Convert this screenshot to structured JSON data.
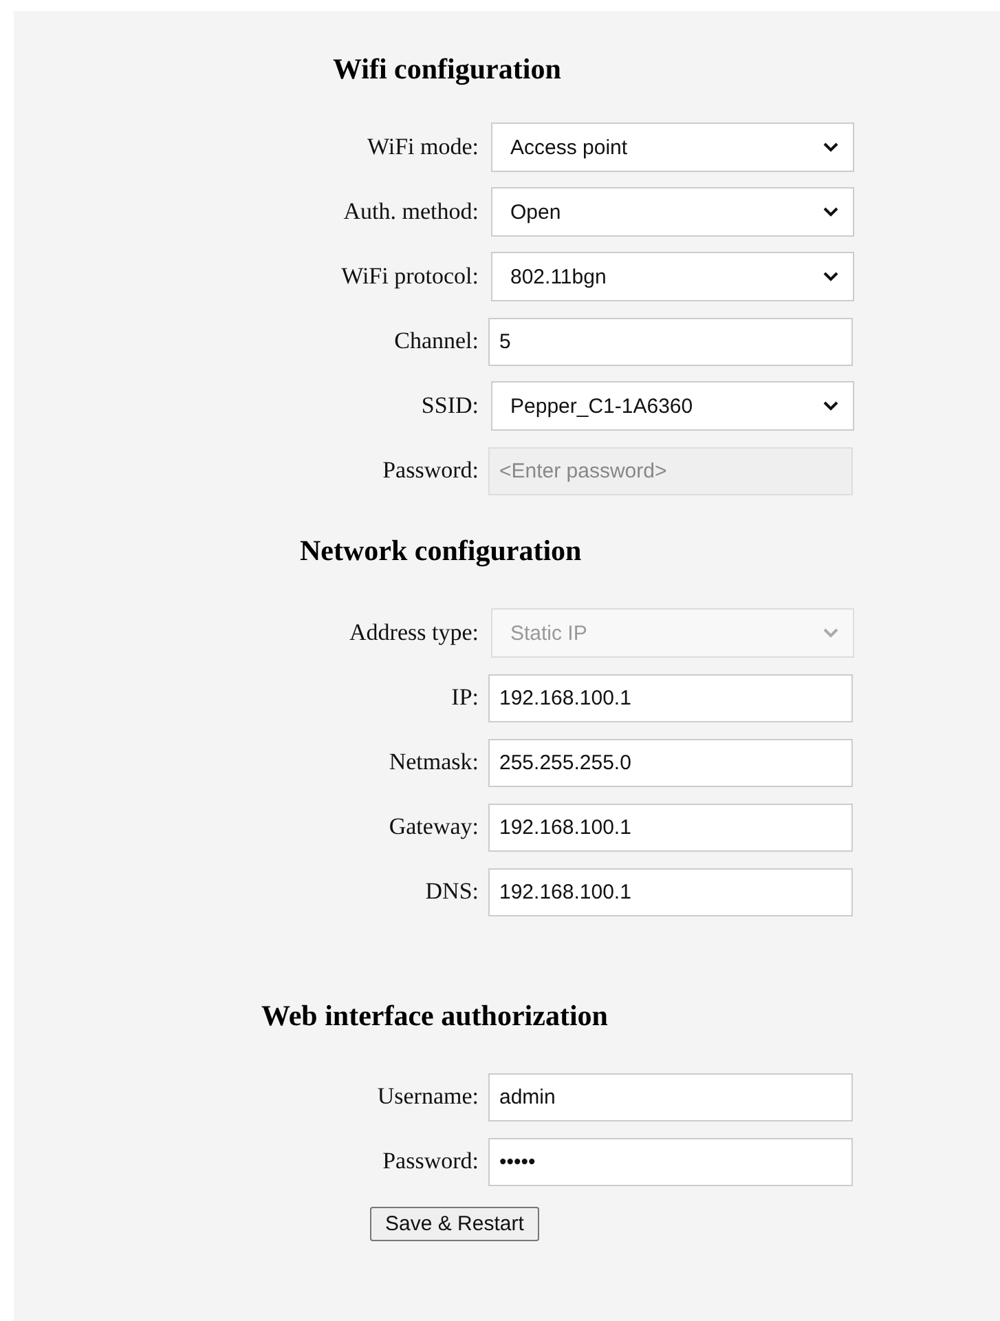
{
  "sections": [
    {
      "title": "Wifi configuration",
      "rows": [
        {
          "label": "WiFi mode:",
          "kind": "select",
          "value": "Access point",
          "disabled": false
        },
        {
          "label": "Auth. method:",
          "kind": "select",
          "value": "Open",
          "disabled": false
        },
        {
          "label": "WiFi protocol:",
          "kind": "select",
          "value": "802.11bgn",
          "disabled": false
        },
        {
          "label": "Channel:",
          "kind": "text",
          "value": "5",
          "disabled": false
        },
        {
          "label": "SSID:",
          "kind": "select",
          "value": "Pepper_C1-1A6360",
          "disabled": false
        },
        {
          "label": "Password:",
          "kind": "text",
          "placeholder": "<Enter password>",
          "disabled": true
        }
      ]
    },
    {
      "title": "Network configuration",
      "rows": [
        {
          "label": "Address type:",
          "kind": "select",
          "value": "Static IP",
          "disabled": true
        },
        {
          "label": "IP:",
          "kind": "text",
          "value": "192.168.100.1",
          "disabled": false
        },
        {
          "label": "Netmask:",
          "kind": "text",
          "value": "255.255.255.0",
          "disabled": false
        },
        {
          "label": "Gateway:",
          "kind": "text",
          "value": "192.168.100.1",
          "disabled": false
        },
        {
          "label": "DNS:",
          "kind": "text",
          "value": "192.168.100.1",
          "disabled": false
        }
      ]
    },
    {
      "title": "Web interface authorization",
      "rows": [
        {
          "label": "Username:",
          "kind": "text",
          "value": "admin",
          "disabled": false
        },
        {
          "label": "Password:",
          "kind": "text",
          "value": "•••••",
          "disabled": false
        }
      ]
    }
  ],
  "button": "Save & Restart"
}
